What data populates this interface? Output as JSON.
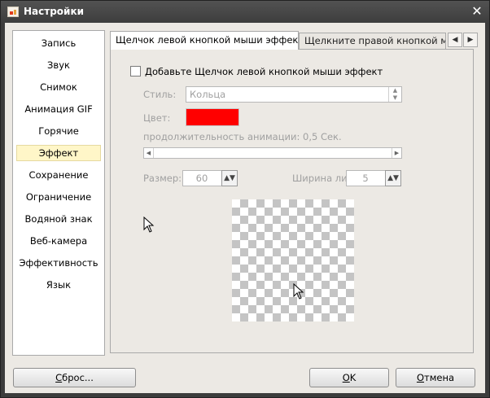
{
  "window": {
    "title": "Настройки",
    "close_glyph": "✕"
  },
  "sidebar": {
    "items": [
      {
        "label": "Запись"
      },
      {
        "label": "Звук"
      },
      {
        "label": "Снимок"
      },
      {
        "label": "Анимация GIF"
      },
      {
        "label": "Горячие клавиши"
      },
      {
        "label": "Эффект",
        "selected": true
      },
      {
        "label": "Сохранение"
      },
      {
        "label": "Ограничение"
      },
      {
        "label": "Водяной знак"
      },
      {
        "label": "Веб-камера"
      },
      {
        "label": "Эффективность"
      },
      {
        "label": "Язык"
      }
    ]
  },
  "tabs": [
    {
      "label": "Щелчок левой кнопкой мыши эффект",
      "active": true
    },
    {
      "label": "Щелкните правой кнопкой мыш",
      "active": false
    }
  ],
  "tab_scroll": {
    "left": "◀",
    "right": "▶"
  },
  "effect": {
    "enable_label": "Добавьте Щелчок левой кнопкой мыши эффект",
    "enabled": false,
    "style_label": "Стиль:",
    "style_value": "Кольца",
    "color_label": "Цвет:",
    "color_value": "#ff0000",
    "duration_label": "продолжительность анимации: 0,5 Сек.",
    "size_label": "Размер:",
    "size_value": "60",
    "width_label": "Ширина ли",
    "width_value": "5"
  },
  "buttons": {
    "reset": {
      "mnemonic": "С",
      "rest": "брос..."
    },
    "ok": {
      "mnemonic": "О",
      "rest": "K"
    },
    "cancel": {
      "mnemonic": "О",
      "rest": "тмена"
    }
  }
}
